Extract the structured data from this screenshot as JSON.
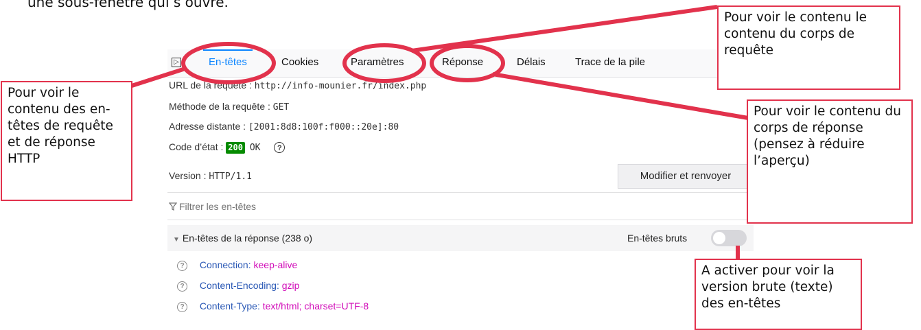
{
  "top_text": "une sous-fenêtre qui s’ouvre.",
  "tabs": [
    {
      "label": "En-têtes",
      "active": true
    },
    {
      "label": "Cookies",
      "active": false
    },
    {
      "label": "Paramètres",
      "active": false
    },
    {
      "label": "Réponse",
      "active": false
    },
    {
      "label": "Délais",
      "active": false
    },
    {
      "label": "Trace de la pile",
      "active": false
    }
  ],
  "request": {
    "url_label": "URL de la requête :",
    "url_value": "http://info-mounier.fr/index.php",
    "method_label": "Méthode de la requête :",
    "method_value": "GET",
    "address_label": "Adresse distante :",
    "address_value": "[2001:8d8:100f:f000::20e]:80",
    "status_label": "Code d’état :",
    "status_code": "200",
    "status_text": "OK",
    "version_label": "Version :",
    "version_value": "HTTP/1.1"
  },
  "resend_button": "Modifier et renvoyer",
  "filter_placeholder": "Filtrer les en-têtes",
  "response_section": {
    "title": "En-têtes de la réponse (238 o)",
    "raw_label": "En-têtes bruts",
    "raw_enabled": false
  },
  "response_headers": [
    {
      "name": "Connection:",
      "value": "keep-alive"
    },
    {
      "name": "Content-Encoding:",
      "value": "gzip"
    },
    {
      "name": "Content-Type:",
      "value": "text/html; charset=UTF-8"
    }
  ],
  "annotations": {
    "headers": "Pour voir le contenu des en-têtes de requête et de réponse HTTP",
    "params": "Pour voir le contenu le contenu du corps de requête",
    "response": "Pour voir le contenu du corps de réponse (pensez à réduire l’aperçu)",
    "raw": "A activer pour voir la version brute (texte) des en-têtes"
  },
  "colors": {
    "accent": "#0a84ff",
    "annotation": "#e2324c",
    "status_ok": "#058b00",
    "header_name": "#2a58b5",
    "header_value": "#d10bb8"
  }
}
